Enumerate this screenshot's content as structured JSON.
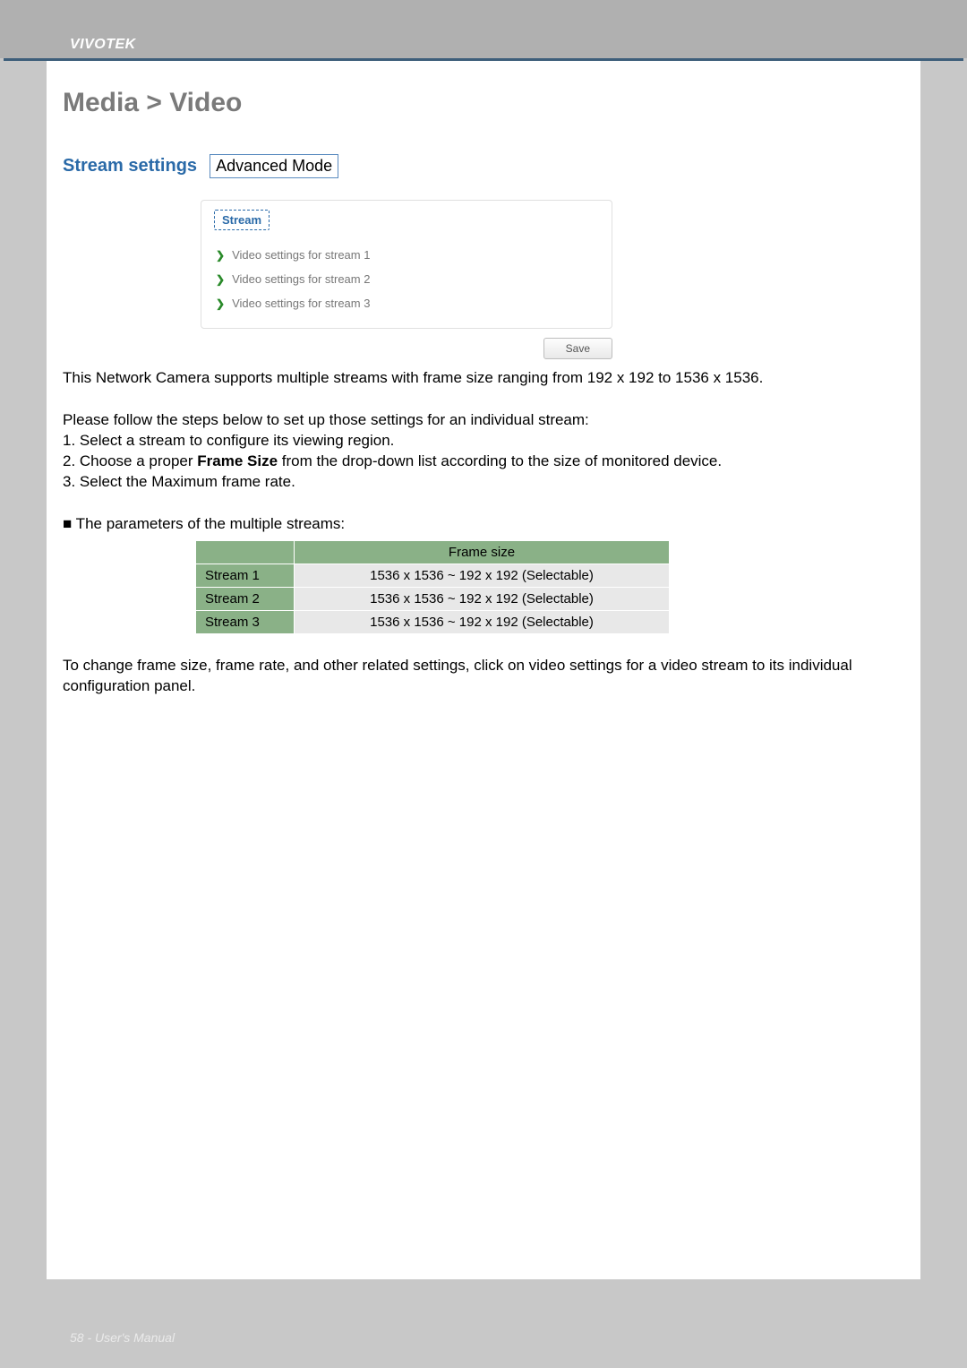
{
  "brand": "VIVOTEK",
  "page_title": "Media > Video",
  "settings_label": "Stream settings",
  "mode_badge": "Advanced Mode",
  "panel": {
    "tab_label": "Stream",
    "rows": [
      {
        "label": "Video settings for stream 1"
      },
      {
        "label": "Video settings for stream 2"
      },
      {
        "label": "Video settings for stream 3"
      }
    ],
    "save_label": "Save"
  },
  "intro_text": "This Network Camera supports multiple streams with frame size ranging from 192 x 192 to 1536 x 1536.",
  "steps_intro": "Please follow the steps below to set up those settings for an individual stream:",
  "steps": [
    "1. Select a stream to configure its viewing region.",
    "2. Choose a proper Frame Size from the drop-down list according to the size of monitored device.",
    "3. Select the Maximum frame rate."
  ],
  "params_heading": "■ The parameters of the multiple streams:",
  "table": {
    "header_frame_size": "Frame size",
    "rows": [
      {
        "name": "Stream 1",
        "value": "1536 x 1536 ~ 192 x 192 (Selectable)"
      },
      {
        "name": "Stream 2",
        "value": "1536 x 1536 ~ 192 x 192 (Selectable)"
      },
      {
        "name": "Stream 3",
        "value": "1536 x 1536 ~ 192 x 192 (Selectable)"
      }
    ]
  },
  "closing_text": "To change frame size, frame rate, and other related settings, click on video settings for a video stream to its individual configuration panel.",
  "footer": "58 - User's Manual",
  "steps_bold_phrase": "Frame Size"
}
